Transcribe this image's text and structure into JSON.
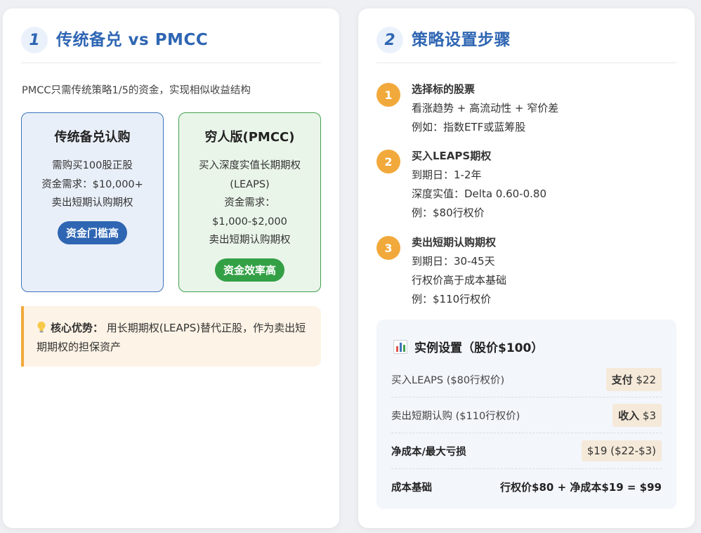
{
  "left": {
    "number": "1",
    "title": "传统备兑 vs PMCC",
    "intro": "PMCC只需传统策略1/5的资金，实现相似收益结构",
    "traditional": {
      "title": "传统备兑认购",
      "body": "需购买100股正股\n资金需求：$10,000+\n卖出短期认购期权",
      "badge": "资金门槛高"
    },
    "pmcc": {
      "title": "穷人版(PMCC)",
      "body": "买入深度实值长期期权\n(LEAPS)\n资金需求：\n$1,000-$2,000\n卖出短期认购期权",
      "badge": "资金效率高"
    },
    "tip": {
      "icon": "lightbulb-icon",
      "label": "核心优势：",
      "text": " 用长期期权(LEAPS)替代正股，作为卖出短期期权的担保资产"
    }
  },
  "right": {
    "number": "2",
    "title": "策略设置步骤",
    "steps": [
      {
        "num": "1",
        "title": "选择标的股票",
        "lines": "看涨趋势 + 高流动性 + 窄价差\n例如：指数ETF或蓝筹股"
      },
      {
        "num": "2",
        "title": "买入LEAPS期权",
        "lines": "到期日：1-2年\n深度实值：Delta 0.60-0.80\n例：$80行权价"
      },
      {
        "num": "3",
        "title": "卖出短期认购期权",
        "lines": "到期日：30-45天\n行权价高于成本基础\n例：$110行权价"
      }
    ],
    "example": {
      "icon": "bar-chart-icon",
      "title": "实例设置（股价$100）",
      "rows": [
        {
          "label": "买入LEAPS ($80行权价)",
          "value_bold": "支付",
          "value": " $22"
        },
        {
          "label": "卖出短期认购 ($110行权价)",
          "value_bold": "收入",
          "value": " $3"
        },
        {
          "label": "净成本/最大亏损",
          "value": "$19 ($22-$3)"
        },
        {
          "label": "成本基础",
          "value": "行权价$80 + 净成本$19 = $99"
        }
      ]
    }
  },
  "colors": {
    "accent_blue": "#2f66b3",
    "accent_green": "#34a046",
    "accent_orange": "#f2a93b"
  }
}
